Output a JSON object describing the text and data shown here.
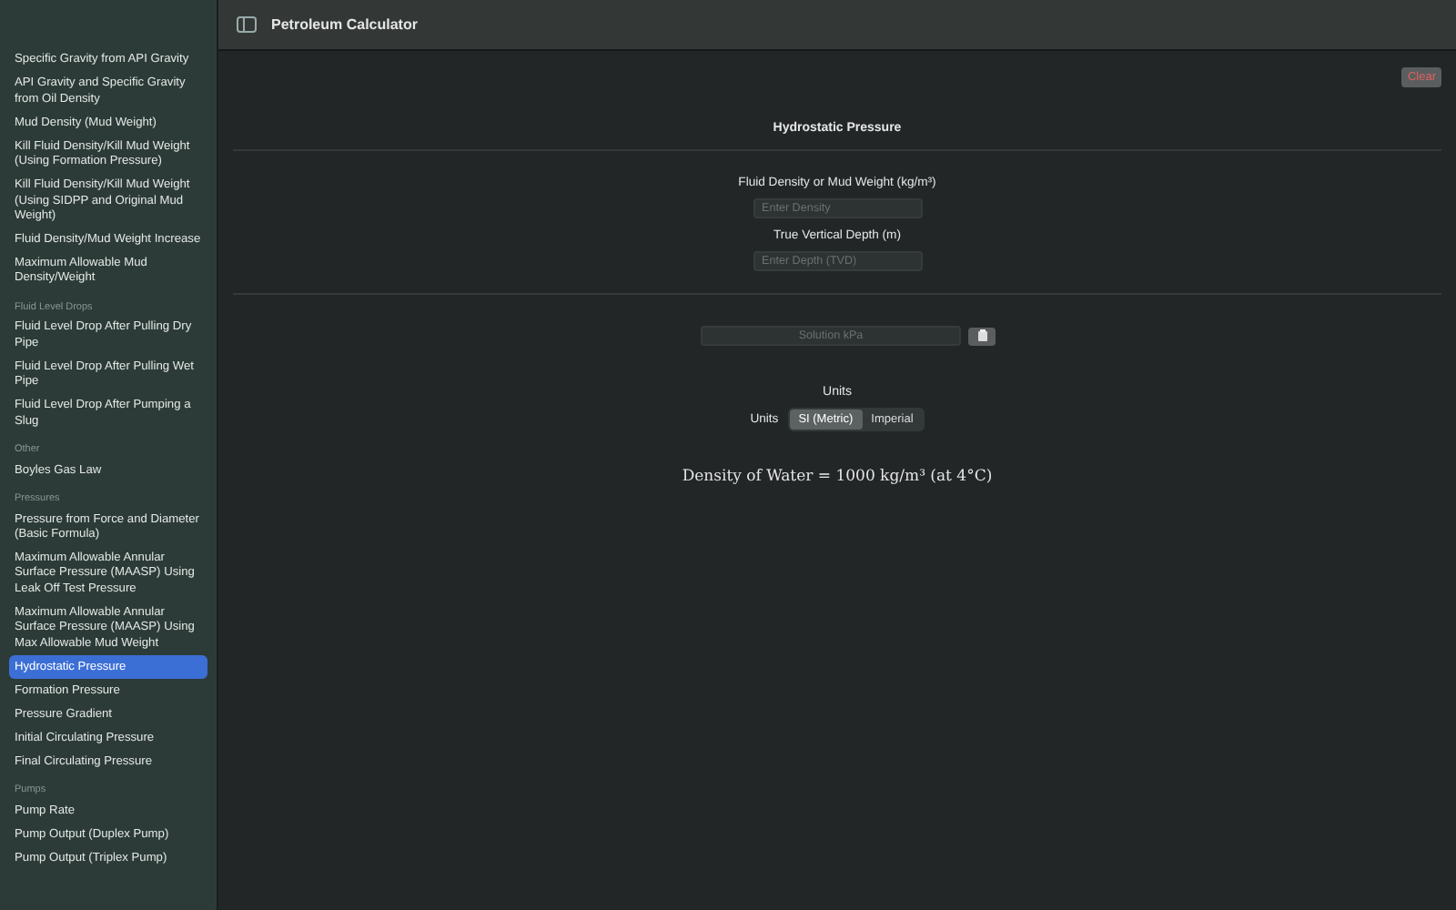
{
  "window": {
    "title": "Petroleum Calculator"
  },
  "sidebar": {
    "items": [
      {
        "kind": "item",
        "label": "Specific Gravity from API Gravity",
        "selected": false
      },
      {
        "kind": "item",
        "label": "API Gravity and Specific Gravity from Oil Density",
        "selected": false
      },
      {
        "kind": "item",
        "label": "Mud Density (Mud Weight)",
        "selected": false
      },
      {
        "kind": "item",
        "label": "Kill Fluid Density/Kill Mud Weight (Using Formation Pressure)",
        "selected": false
      },
      {
        "kind": "item",
        "label": "Kill Fluid Density/Kill Mud Weight (Using SIDPP and Original Mud Weight)",
        "selected": false
      },
      {
        "kind": "item",
        "label": "Fluid Density/Mud Weight Increase",
        "selected": false
      },
      {
        "kind": "item",
        "label": "Maximum Allowable Mud Density/Weight",
        "selected": false
      },
      {
        "kind": "header",
        "label": "Fluid Level Drops"
      },
      {
        "kind": "item",
        "label": "Fluid Level Drop After Pulling Dry Pipe",
        "selected": false
      },
      {
        "kind": "item",
        "label": "Fluid Level Drop After Pulling Wet Pipe",
        "selected": false
      },
      {
        "kind": "item",
        "label": "Fluid Level Drop After Pumping a Slug",
        "selected": false
      },
      {
        "kind": "header",
        "label": "Other"
      },
      {
        "kind": "item",
        "label": "Boyles Gas Law",
        "selected": false
      },
      {
        "kind": "header",
        "label": "Pressures"
      },
      {
        "kind": "item",
        "label": "Pressure from Force and Diameter (Basic Formula)",
        "selected": false
      },
      {
        "kind": "item",
        "label": "Maximum Allowable Annular Surface Pressure (MAASP) Using Leak Off Test Pressure",
        "selected": false
      },
      {
        "kind": "item",
        "label": "Maximum Allowable Annular Surface Pressure (MAASP) Using Max Allowable Mud Weight",
        "selected": false
      },
      {
        "kind": "item",
        "label": "Hydrostatic Pressure",
        "selected": true
      },
      {
        "kind": "item",
        "label": "Formation Pressure",
        "selected": false
      },
      {
        "kind": "item",
        "label": "Pressure Gradient",
        "selected": false
      },
      {
        "kind": "item",
        "label": "Initial Circulating Pressure",
        "selected": false
      },
      {
        "kind": "item",
        "label": "Final Circulating Pressure",
        "selected": false
      },
      {
        "kind": "header",
        "label": "Pumps"
      },
      {
        "kind": "item",
        "label": "Pump Rate",
        "selected": false
      },
      {
        "kind": "item",
        "label": "Pump Output (Duplex Pump)",
        "selected": false
      },
      {
        "kind": "item",
        "label": "Pump Output (Triplex Pump)",
        "selected": false
      }
    ]
  },
  "main": {
    "clear_button": "Clear",
    "title": "Hydrostatic Pressure",
    "fields": [
      {
        "label": "Fluid Density or Mud Weight (kg/m³)",
        "placeholder": "Enter Density"
      },
      {
        "label": "True Vertical Depth (m)",
        "placeholder": "Enter Depth (TVD)"
      }
    ],
    "solution": {
      "placeholder": "Solution kPa"
    },
    "units": {
      "heading": "Units",
      "label": "Units",
      "options": [
        {
          "label": "SI (Metric)",
          "selected": true
        },
        {
          "label": "Imperial",
          "selected": false
        }
      ]
    },
    "note": "Density of Water = 1000 kg/m³ (at 4°C)"
  }
}
